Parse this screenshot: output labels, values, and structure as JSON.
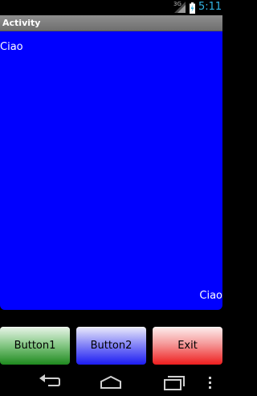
{
  "status_bar": {
    "network_label": "3G",
    "time": "5:11"
  },
  "title_bar": {
    "title": "Activity"
  },
  "content": {
    "top_text": "Ciao",
    "bottom_text": "Ciao",
    "background_color": "#0000ff"
  },
  "buttons": [
    {
      "label": "Button1",
      "color": "green"
    },
    {
      "label": "Button2",
      "color": "blue"
    },
    {
      "label": "Exit",
      "color": "red"
    }
  ],
  "nav_bar": {
    "icons": [
      "back-icon",
      "home-icon",
      "recent-apps-icon",
      "overflow-menu-icon"
    ]
  }
}
